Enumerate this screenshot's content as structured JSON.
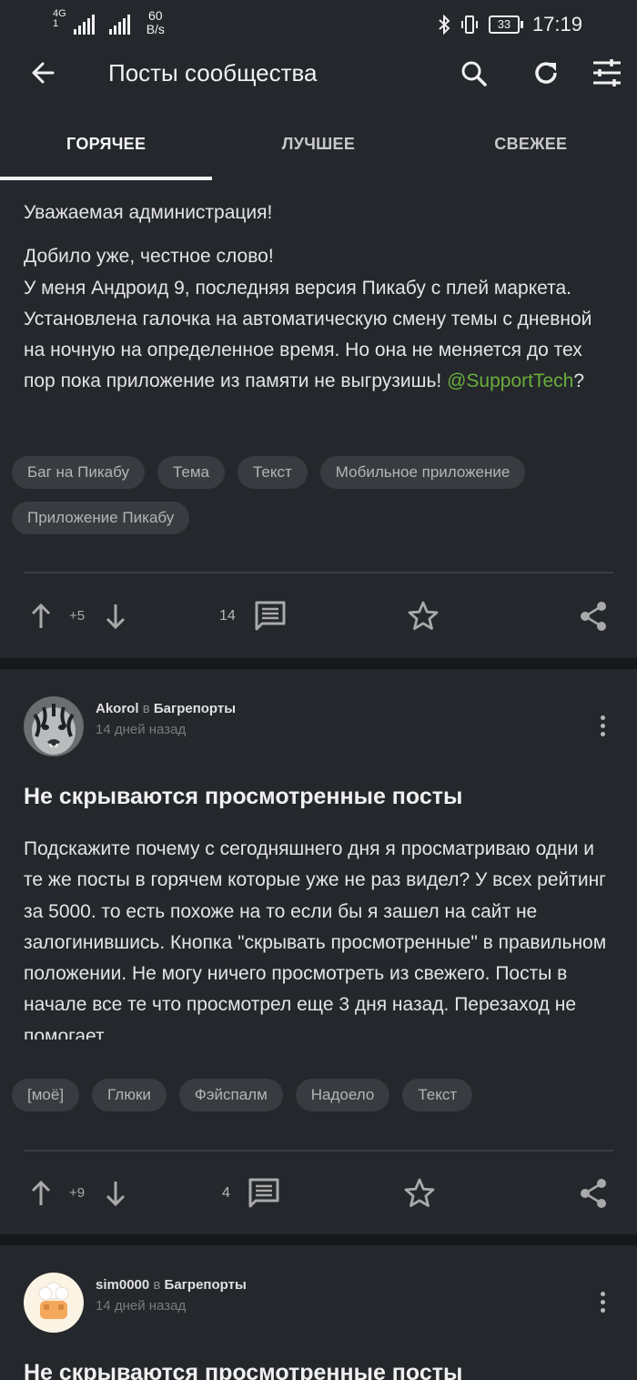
{
  "status_bar": {
    "network1": "4G",
    "network2": "1",
    "speed_value": "60",
    "speed_unit": "B/s",
    "battery": "33",
    "time": "17:19"
  },
  "app_bar": {
    "title": "Посты сообщества",
    "icons": [
      "arrow-back-icon",
      "search-icon",
      "refresh-icon",
      "filter-sliders-icon"
    ]
  },
  "tabs": [
    {
      "label": "ГОРЯЧЕЕ",
      "active": true
    },
    {
      "label": "ЛУЧШЕЕ",
      "active": false
    },
    {
      "label": "СВЕЖЕЕ",
      "active": false
    }
  ],
  "posts": [
    {
      "body_lines": [
        "Уважаемая администрация!",
        "Добило уже, честное слово!",
        "У меня Андроид 9, последняя версия Пикабу с плей маркета.",
        "Установлена галочка на автоматическую смену темы с дневной на ночную на определенное время. Но она не меняется до тех пор пока приложение из памяти не выгрузишь! ",
        "?"
      ],
      "mention": "@SupportTech",
      "tags": [
        "Баг на Пикабу",
        "Тема",
        "Текст",
        "Мобильное приложение",
        "Приложение Пикабу"
      ],
      "rating": "+5",
      "comments": "14"
    },
    {
      "author": "Akorol",
      "in_word": "в",
      "community": "Багрепорты",
      "date": "14 дней назад",
      "title": "Не скрываются просмотренные посты",
      "body": "Подскажите почему с сегодняшнего дня я просматриваю одни и те же посты в горячем которые уже не раз видел? У всех рейтинг за 5000. то есть похоже на то если бы я зашел на сайт не залогинившись. Кнопка \"скрывать просмотренные\" в правильном положении. Не могу ничего просмотреть из свежего. Посты в начале все те что просмотрел еще 3 дня назад. Перезаход не помогает.",
      "tags": [
        "[моё]",
        "Глюки",
        "Фэйспалм",
        "Надоело",
        "Текст"
      ],
      "rating": "+9",
      "comments": "4"
    },
    {
      "author": "sim0000",
      "in_word": "в",
      "community": "Багрепорты",
      "date": "14 дней назад",
      "title": "Не скрываются просмотренные посты"
    }
  ],
  "colors": {
    "background": "#16191c",
    "card": "#24272b",
    "tag_bg": "#383c41",
    "mention": "#6aae3c",
    "text": "#e4e4e4"
  }
}
